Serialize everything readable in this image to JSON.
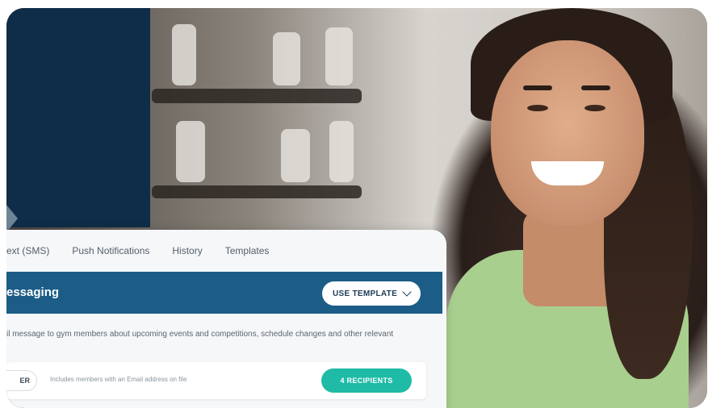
{
  "tabs": [
    "ext (SMS)",
    "Push Notifications",
    "History",
    "Templates"
  ],
  "messaging": {
    "title": "essaging",
    "use_template_label": "USE TEMPLATE",
    "description": "il message to gym members about upcoming events and competitions, schedule changes and other relevant"
  },
  "recipients_row": {
    "filter_label": "ER",
    "note": "Includes members with an Email address on file",
    "recipients_label": "4 RECIPIENTS"
  },
  "colors": {
    "navy": "#0f2d48",
    "header": "#1b5d86",
    "accent": "#1fbba7"
  }
}
